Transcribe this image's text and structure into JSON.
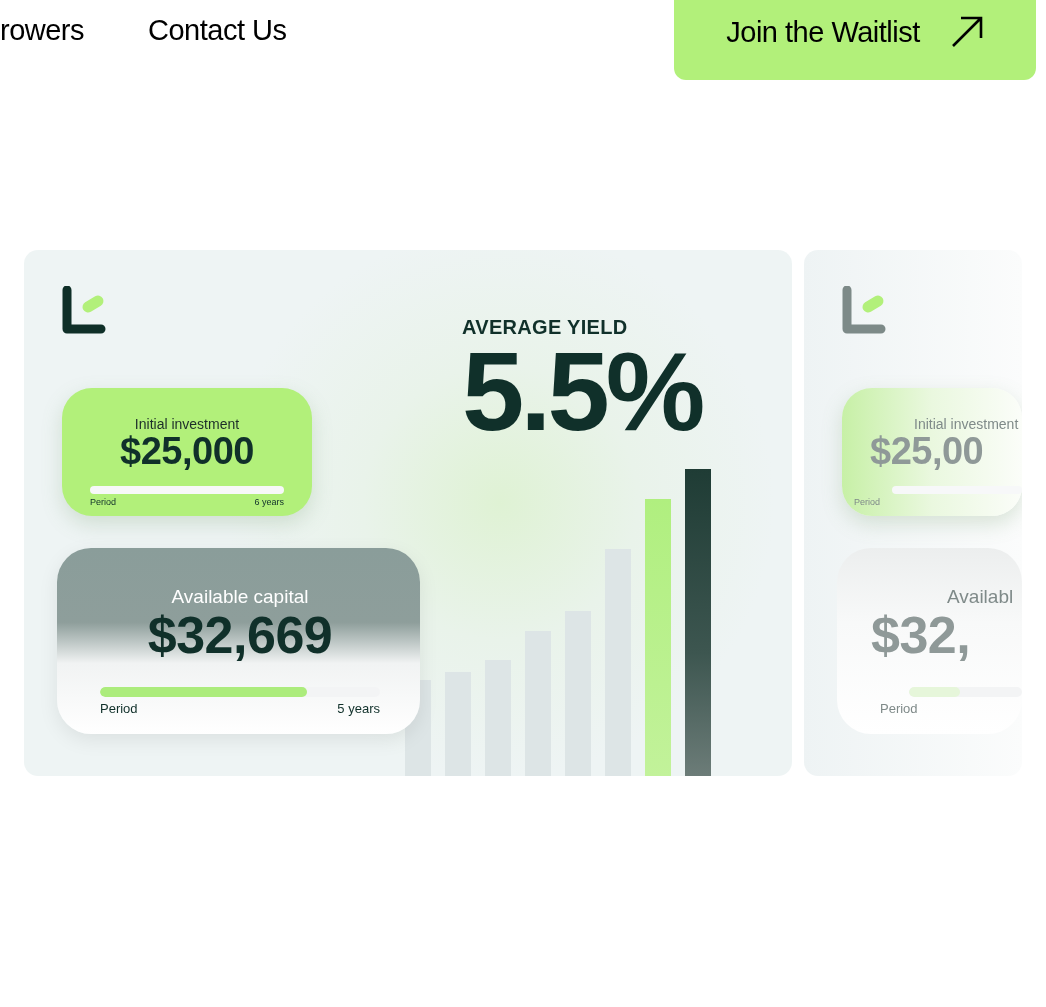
{
  "nav": {
    "links": [
      {
        "label": "rowers"
      },
      {
        "label": "Contact Us"
      }
    ],
    "cta": {
      "label": "Join the Waitlist"
    }
  },
  "cards": [
    {
      "kind": "main",
      "yield_label": "AVERAGE YIELD",
      "yield_value": "5.5%",
      "investment": {
        "label": "Initial investment",
        "amount": "$25,000",
        "period_label": "Period",
        "period_value": "6 years"
      },
      "capital": {
        "label": "Available capital",
        "amount": "$32,669",
        "period_label": "Period",
        "period_value": "5 years",
        "level": 0.74
      }
    },
    {
      "kind": "faded",
      "investment": {
        "label": "Initial investment",
        "amount": "$25,00",
        "period_label": "Period"
      },
      "capital": {
        "label": "Availabl",
        "amount": "$32,",
        "period_label": "Period",
        "level": 0.45
      }
    }
  ]
}
